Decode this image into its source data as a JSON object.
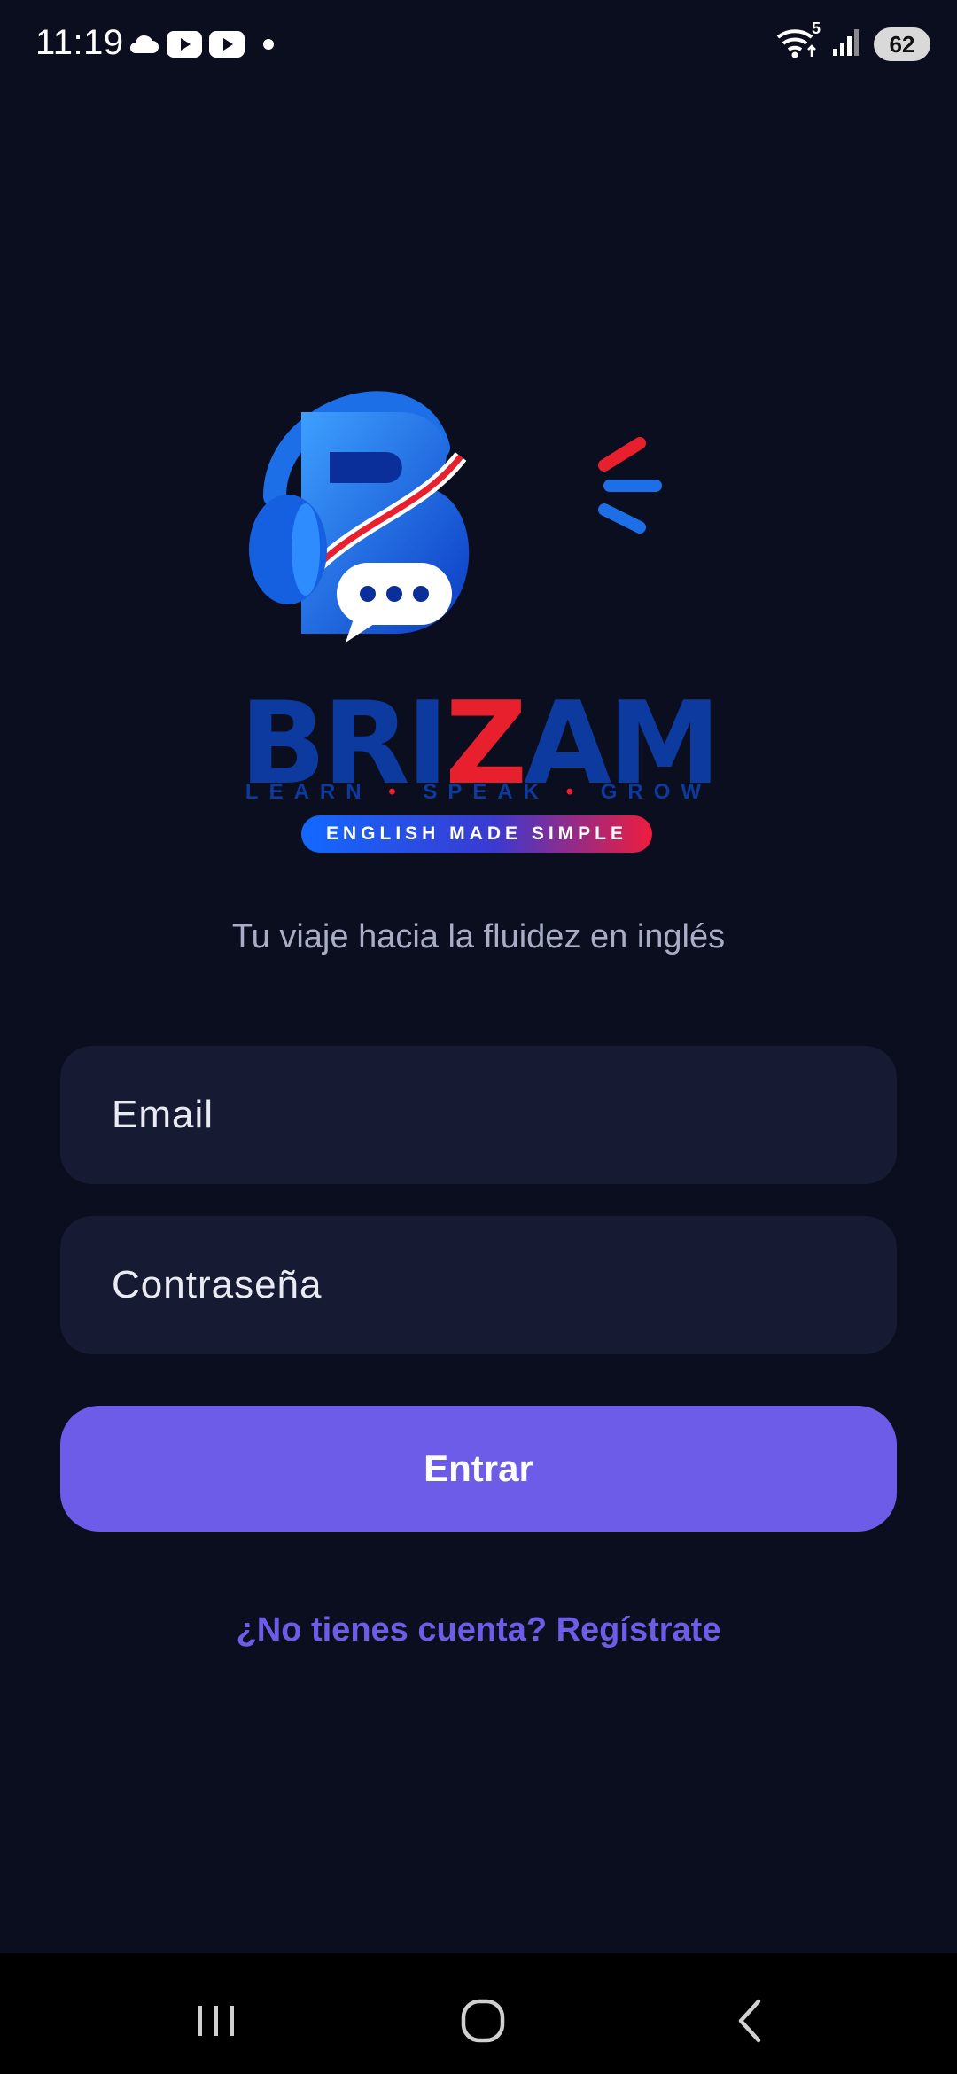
{
  "status_bar": {
    "time": "11:19",
    "left_icons": [
      "cloud-icon",
      "youtube-icon",
      "youtube-icon",
      "notification-dot-icon"
    ],
    "wifi_badge": "5",
    "battery": "62"
  },
  "brand": {
    "name_part1": "BRI",
    "name_z": "Z",
    "name_part2": "AM",
    "tagline_words": [
      "LEARN",
      "SPEAK",
      "GROW"
    ],
    "pill": "ENGLISH MADE SIMPLE",
    "colors": {
      "blue": "#1269ff",
      "red": "#ef1c3d",
      "navy": "#0d3a9e"
    }
  },
  "login": {
    "subtitle": "Tu viaje hacia la fluidez en inglés",
    "email_placeholder": "Email",
    "password_placeholder": "Contraseña",
    "submit_label": "Entrar",
    "register_link": "¿No tienes cuenta? Regístrate"
  },
  "colors": {
    "background": "#0b0e1e",
    "field": "#161b33",
    "accent": "#6c5ce7"
  },
  "nav_bar": {
    "buttons": [
      "recents-icon",
      "home-icon",
      "back-icon"
    ]
  }
}
